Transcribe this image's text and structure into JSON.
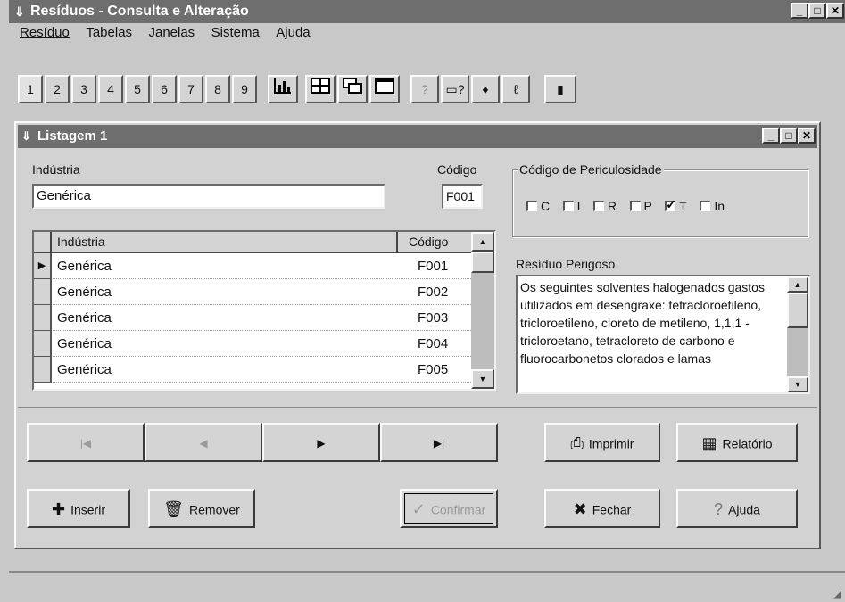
{
  "app": {
    "title": "Resíduos - Consulta e Alteração",
    "menu": [
      "Resíduo",
      "Tabelas",
      "Janelas",
      "Sistema",
      "Ajuda"
    ],
    "toolbar_numbers": [
      "1",
      "2",
      "3",
      "4",
      "5",
      "6",
      "7",
      "8",
      "9"
    ]
  },
  "window": {
    "title": "Listagem 1",
    "industria_label": "Indústria",
    "industria_value": "Genérica",
    "codigo_label": "Código",
    "codigo_value": "F001",
    "periculosidade": {
      "title": "Código de Periculosidade",
      "options": [
        {
          "label": "C",
          "checked": false
        },
        {
          "label": "I",
          "checked": false
        },
        {
          "label": "R",
          "checked": false
        },
        {
          "label": "P",
          "checked": false
        },
        {
          "label": "T",
          "checked": true
        },
        {
          "label": "In",
          "checked": false
        }
      ]
    },
    "grid": {
      "headers": [
        "Indústria",
        "Código"
      ],
      "rows": [
        [
          "Genérica",
          "F001"
        ],
        [
          "Genérica",
          "F002"
        ],
        [
          "Genérica",
          "F003"
        ],
        [
          "Genérica",
          "F004"
        ],
        [
          "Genérica",
          "F005"
        ]
      ]
    },
    "residuo": {
      "label": "Resíduo Perigoso",
      "text": "Os seguintes solventes halogenados gastos utilizados em desengraxe: tetracloroetileno, tricloroetileno, cloreto de metileno, 1,1,1 - tricloroetano, tetracloreto de carbono e fluorocarbonetos clorados e lamas"
    },
    "buttons": {
      "imprimir": "Imprimir",
      "relatorio": "Relatório",
      "inserir": "Inserir",
      "remover": "Remover",
      "confirmar": "Confirmar",
      "fechar": "Fechar",
      "ajuda": "Ajuda"
    }
  }
}
